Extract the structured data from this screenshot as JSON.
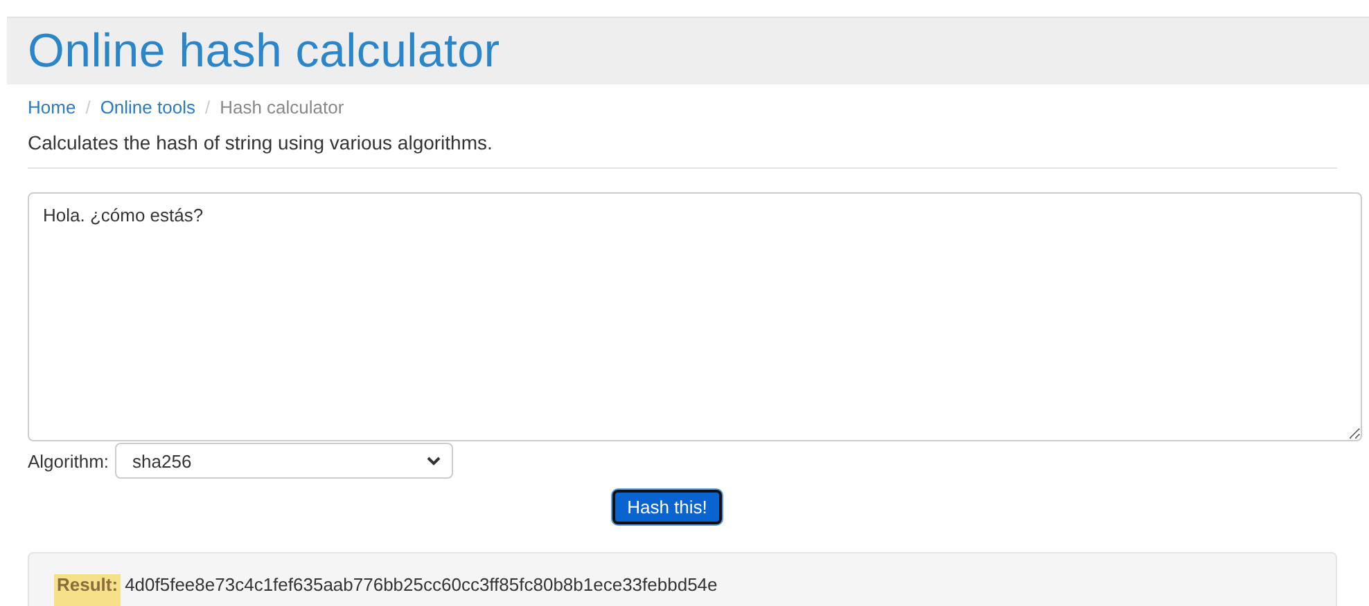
{
  "page": {
    "title": "Online hash calculator"
  },
  "breadcrumb": [
    {
      "label": "Home",
      "kind": "link"
    },
    {
      "label": "Online tools",
      "kind": "link"
    },
    {
      "label": "Hash calculator",
      "kind": "current"
    }
  ],
  "separator": "/",
  "description": "Calculates the hash of string using various algorithms.",
  "input": {
    "value": "Hola. ¿cómo estás?"
  },
  "algorithm": {
    "label": "Algorithm:",
    "value": "sha256"
  },
  "button": "Hash this!",
  "result": {
    "label": "Result:",
    "value": "4d0f5fee8e73c4c1fef635aab776bb25cc60cc3ff85fc80b8b1ece33febbd54e"
  }
}
